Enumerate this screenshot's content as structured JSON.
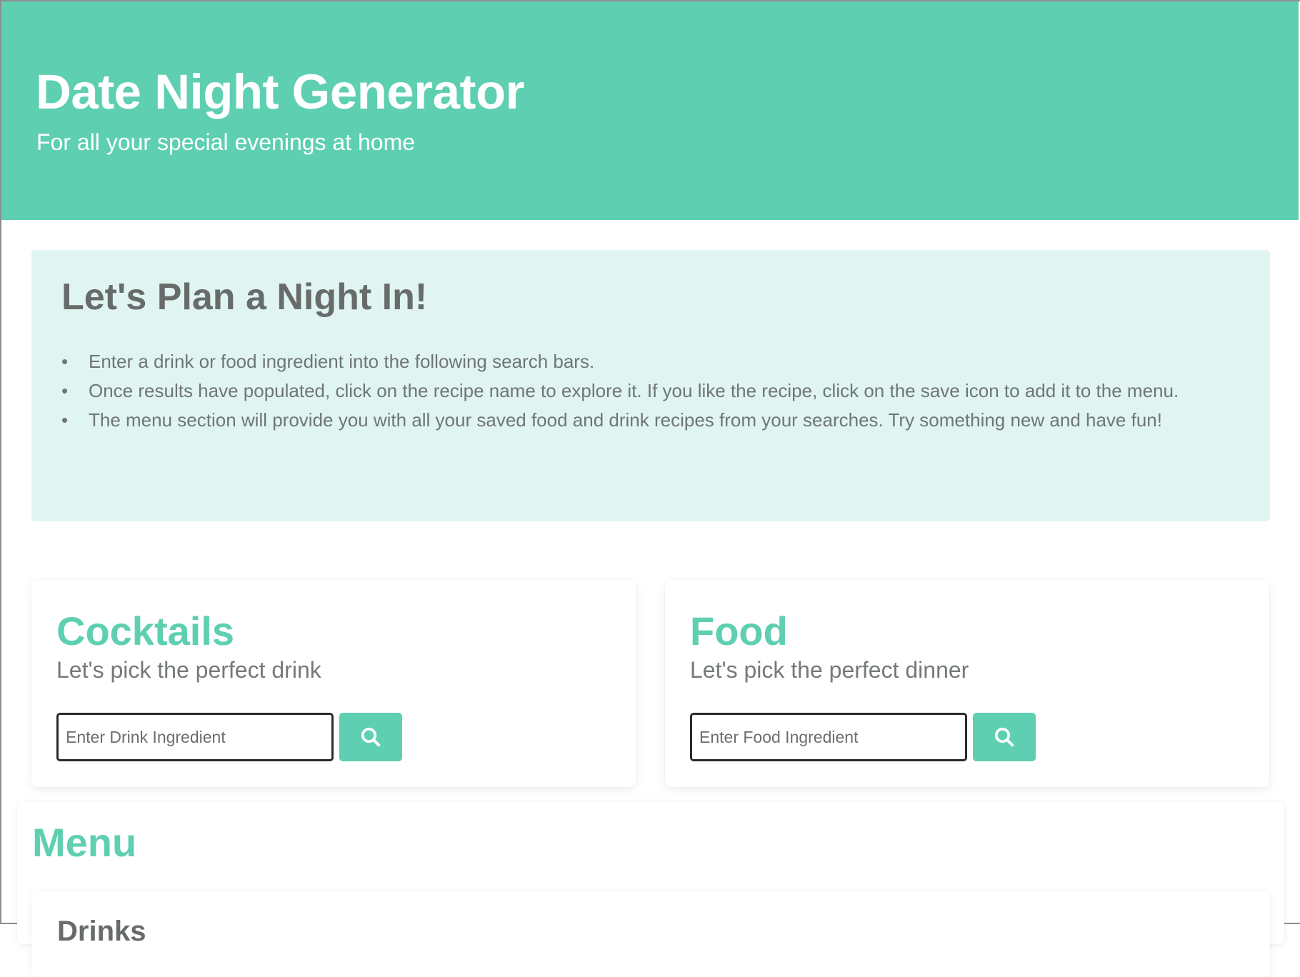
{
  "hero": {
    "title": "Date Night Generator",
    "subtitle": "For all your special evenings at home"
  },
  "intro": {
    "heading": "Let's Plan a Night In!",
    "bullets": [
      "Enter a drink or food ingredient into the following search bars.",
      "Once results have populated, click on the recipe name to explore it. If you like the recipe, click on the save icon to add it to the menu.",
      "The menu section will provide you with all your saved food and drink recipes from your searches. Try something new and have fun!"
    ]
  },
  "cocktails": {
    "title": "Cocktails",
    "subtitle": "Let's pick the perfect drink",
    "placeholder": "Enter Drink Ingredient",
    "icon": "search-icon"
  },
  "food": {
    "title": "Food",
    "subtitle": "Let's pick the perfect dinner",
    "placeholder": "Enter Food Ingredient",
    "icon": "search-icon"
  },
  "menu": {
    "title": "Menu",
    "drinks_title": "Drinks"
  },
  "colors": {
    "accent": "#5ecfb1",
    "intro_bg": "#e0f5f2",
    "text_gray": "#6f7675"
  }
}
